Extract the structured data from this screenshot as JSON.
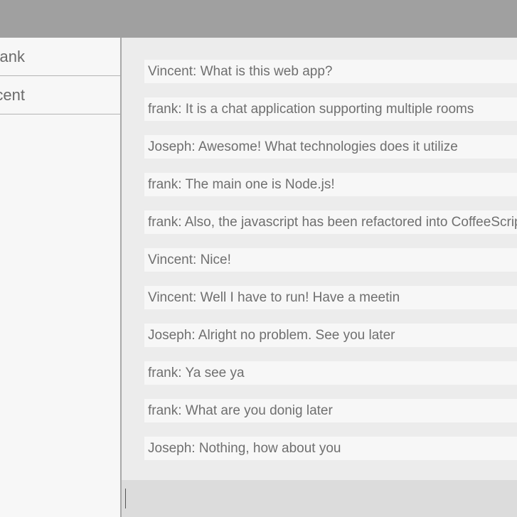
{
  "sidebar": {
    "users": [
      {
        "label": "frank"
      },
      {
        "label": "Vincent"
      }
    ]
  },
  "chat": {
    "messages": [
      {
        "text": "Vincent: What is this web app?"
      },
      {
        "text": "frank: It is a chat application supporting multiple rooms"
      },
      {
        "text": "Joseph: Awesome! What technologies does it utilize"
      },
      {
        "text": "frank: The main one is Node.js!"
      },
      {
        "text": "frank: Also, the javascript has been refactored into CoffeeScript"
      },
      {
        "text": "Vincent: Nice!"
      },
      {
        "text": "Vincent: Well I have to run! Have a meetin"
      },
      {
        "text": "Joseph: Alright no problem. See you later"
      },
      {
        "text": "frank: Ya see ya"
      },
      {
        "text": "frank: What are you donig later"
      },
      {
        "text": "Joseph: Nothing, how about you"
      }
    ]
  },
  "input": {
    "value": ""
  }
}
